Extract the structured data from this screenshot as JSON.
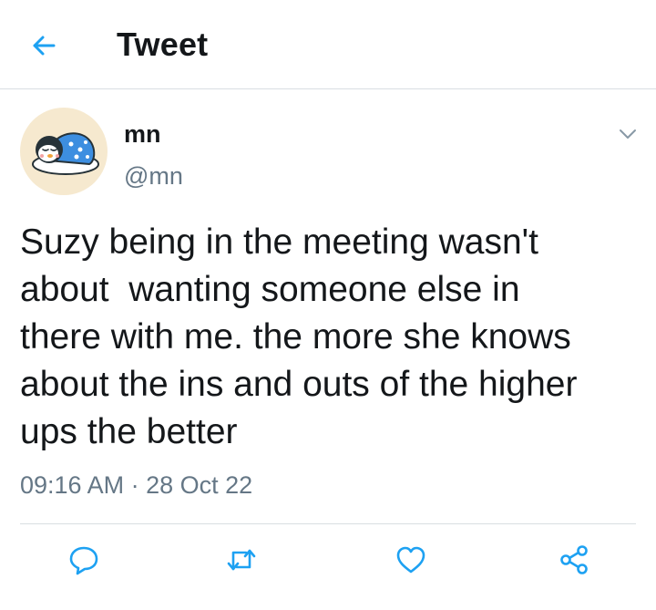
{
  "header": {
    "title": "Tweet",
    "back_icon": "arrow-left-icon"
  },
  "accent_color": "#1da1f2",
  "tweet": {
    "display_name": "mn",
    "handle": "@mn",
    "avatar": "penguin-sleeping-avatar",
    "text": "Suzy being in the meeting wasn't\nabout  wanting someone else in\nthere with me. the more she knows\nabout the ins and outs of the higher\nups the better",
    "time": "09:16 AM",
    "separator": " · ",
    "date": "28 Oct 22"
  },
  "actions": [
    "reply-icon",
    "retweet-icon",
    "like-icon",
    "share-icon"
  ]
}
